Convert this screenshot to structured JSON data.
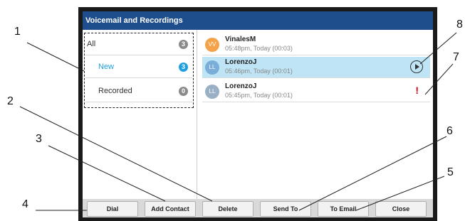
{
  "window": {
    "title": "Voicemail and Recordings"
  },
  "categories": [
    {
      "label": "All",
      "count": "3",
      "badge_color": "#8a8a8a",
      "text_color": "#333333"
    },
    {
      "label": "New",
      "count": "3",
      "badge_color": "#1ea0e0",
      "text_color": "#1ea0e0"
    },
    {
      "label": "Recorded",
      "count": "0",
      "badge_color": "#8a8a8a",
      "text_color": "#333333"
    }
  ],
  "messages": [
    {
      "initials": "VV",
      "avatar_color": "#f4a34a",
      "name": "VinalesM",
      "time": "05:48pm, Today (00:03)",
      "selected": false,
      "icon": ""
    },
    {
      "initials": "LL",
      "avatar_color": "#7aaed8",
      "name": "LorenzoJ",
      "time": "05:46pm, Today (00:01)",
      "selected": true,
      "icon": "play-icon"
    },
    {
      "initials": "LL",
      "avatar_color": "#9ab0c4",
      "name": "LorenzoJ",
      "time": "05:45pm, Today (00:01)",
      "selected": false,
      "icon": "urgent-icon"
    }
  ],
  "softkeys": [
    "Dial",
    "Add Contact",
    "Delete",
    "Send To",
    "To Email",
    "Close"
  ],
  "urgent_mark": "!",
  "callouts": [
    "1",
    "2",
    "3",
    "4",
    "5",
    "6",
    "7",
    "8"
  ]
}
